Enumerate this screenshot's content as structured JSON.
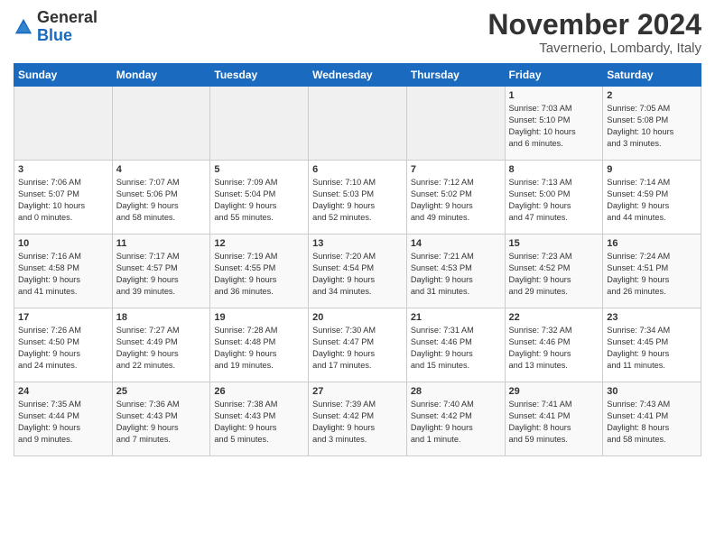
{
  "logo": {
    "general": "General",
    "blue": "Blue"
  },
  "title": "November 2024",
  "location": "Tavernerio, Lombardy, Italy",
  "days_of_week": [
    "Sunday",
    "Monday",
    "Tuesday",
    "Wednesday",
    "Thursday",
    "Friday",
    "Saturday"
  ],
  "weeks": [
    [
      {
        "day": "",
        "info": ""
      },
      {
        "day": "",
        "info": ""
      },
      {
        "day": "",
        "info": ""
      },
      {
        "day": "",
        "info": ""
      },
      {
        "day": "",
        "info": ""
      },
      {
        "day": "1",
        "info": "Sunrise: 7:03 AM\nSunset: 5:10 PM\nDaylight: 10 hours\nand 6 minutes."
      },
      {
        "day": "2",
        "info": "Sunrise: 7:05 AM\nSunset: 5:08 PM\nDaylight: 10 hours\nand 3 minutes."
      }
    ],
    [
      {
        "day": "3",
        "info": "Sunrise: 7:06 AM\nSunset: 5:07 PM\nDaylight: 10 hours\nand 0 minutes."
      },
      {
        "day": "4",
        "info": "Sunrise: 7:07 AM\nSunset: 5:06 PM\nDaylight: 9 hours\nand 58 minutes."
      },
      {
        "day": "5",
        "info": "Sunrise: 7:09 AM\nSunset: 5:04 PM\nDaylight: 9 hours\nand 55 minutes."
      },
      {
        "day": "6",
        "info": "Sunrise: 7:10 AM\nSunset: 5:03 PM\nDaylight: 9 hours\nand 52 minutes."
      },
      {
        "day": "7",
        "info": "Sunrise: 7:12 AM\nSunset: 5:02 PM\nDaylight: 9 hours\nand 49 minutes."
      },
      {
        "day": "8",
        "info": "Sunrise: 7:13 AM\nSunset: 5:00 PM\nDaylight: 9 hours\nand 47 minutes."
      },
      {
        "day": "9",
        "info": "Sunrise: 7:14 AM\nSunset: 4:59 PM\nDaylight: 9 hours\nand 44 minutes."
      }
    ],
    [
      {
        "day": "10",
        "info": "Sunrise: 7:16 AM\nSunset: 4:58 PM\nDaylight: 9 hours\nand 41 minutes."
      },
      {
        "day": "11",
        "info": "Sunrise: 7:17 AM\nSunset: 4:57 PM\nDaylight: 9 hours\nand 39 minutes."
      },
      {
        "day": "12",
        "info": "Sunrise: 7:19 AM\nSunset: 4:55 PM\nDaylight: 9 hours\nand 36 minutes."
      },
      {
        "day": "13",
        "info": "Sunrise: 7:20 AM\nSunset: 4:54 PM\nDaylight: 9 hours\nand 34 minutes."
      },
      {
        "day": "14",
        "info": "Sunrise: 7:21 AM\nSunset: 4:53 PM\nDaylight: 9 hours\nand 31 minutes."
      },
      {
        "day": "15",
        "info": "Sunrise: 7:23 AM\nSunset: 4:52 PM\nDaylight: 9 hours\nand 29 minutes."
      },
      {
        "day": "16",
        "info": "Sunrise: 7:24 AM\nSunset: 4:51 PM\nDaylight: 9 hours\nand 26 minutes."
      }
    ],
    [
      {
        "day": "17",
        "info": "Sunrise: 7:26 AM\nSunset: 4:50 PM\nDaylight: 9 hours\nand 24 minutes."
      },
      {
        "day": "18",
        "info": "Sunrise: 7:27 AM\nSunset: 4:49 PM\nDaylight: 9 hours\nand 22 minutes."
      },
      {
        "day": "19",
        "info": "Sunrise: 7:28 AM\nSunset: 4:48 PM\nDaylight: 9 hours\nand 19 minutes."
      },
      {
        "day": "20",
        "info": "Sunrise: 7:30 AM\nSunset: 4:47 PM\nDaylight: 9 hours\nand 17 minutes."
      },
      {
        "day": "21",
        "info": "Sunrise: 7:31 AM\nSunset: 4:46 PM\nDaylight: 9 hours\nand 15 minutes."
      },
      {
        "day": "22",
        "info": "Sunrise: 7:32 AM\nSunset: 4:46 PM\nDaylight: 9 hours\nand 13 minutes."
      },
      {
        "day": "23",
        "info": "Sunrise: 7:34 AM\nSunset: 4:45 PM\nDaylight: 9 hours\nand 11 minutes."
      }
    ],
    [
      {
        "day": "24",
        "info": "Sunrise: 7:35 AM\nSunset: 4:44 PM\nDaylight: 9 hours\nand 9 minutes."
      },
      {
        "day": "25",
        "info": "Sunrise: 7:36 AM\nSunset: 4:43 PM\nDaylight: 9 hours\nand 7 minutes."
      },
      {
        "day": "26",
        "info": "Sunrise: 7:38 AM\nSunset: 4:43 PM\nDaylight: 9 hours\nand 5 minutes."
      },
      {
        "day": "27",
        "info": "Sunrise: 7:39 AM\nSunset: 4:42 PM\nDaylight: 9 hours\nand 3 minutes."
      },
      {
        "day": "28",
        "info": "Sunrise: 7:40 AM\nSunset: 4:42 PM\nDaylight: 9 hours\nand 1 minute."
      },
      {
        "day": "29",
        "info": "Sunrise: 7:41 AM\nSunset: 4:41 PM\nDaylight: 8 hours\nand 59 minutes."
      },
      {
        "day": "30",
        "info": "Sunrise: 7:43 AM\nSunset: 4:41 PM\nDaylight: 8 hours\nand 58 minutes."
      }
    ]
  ]
}
